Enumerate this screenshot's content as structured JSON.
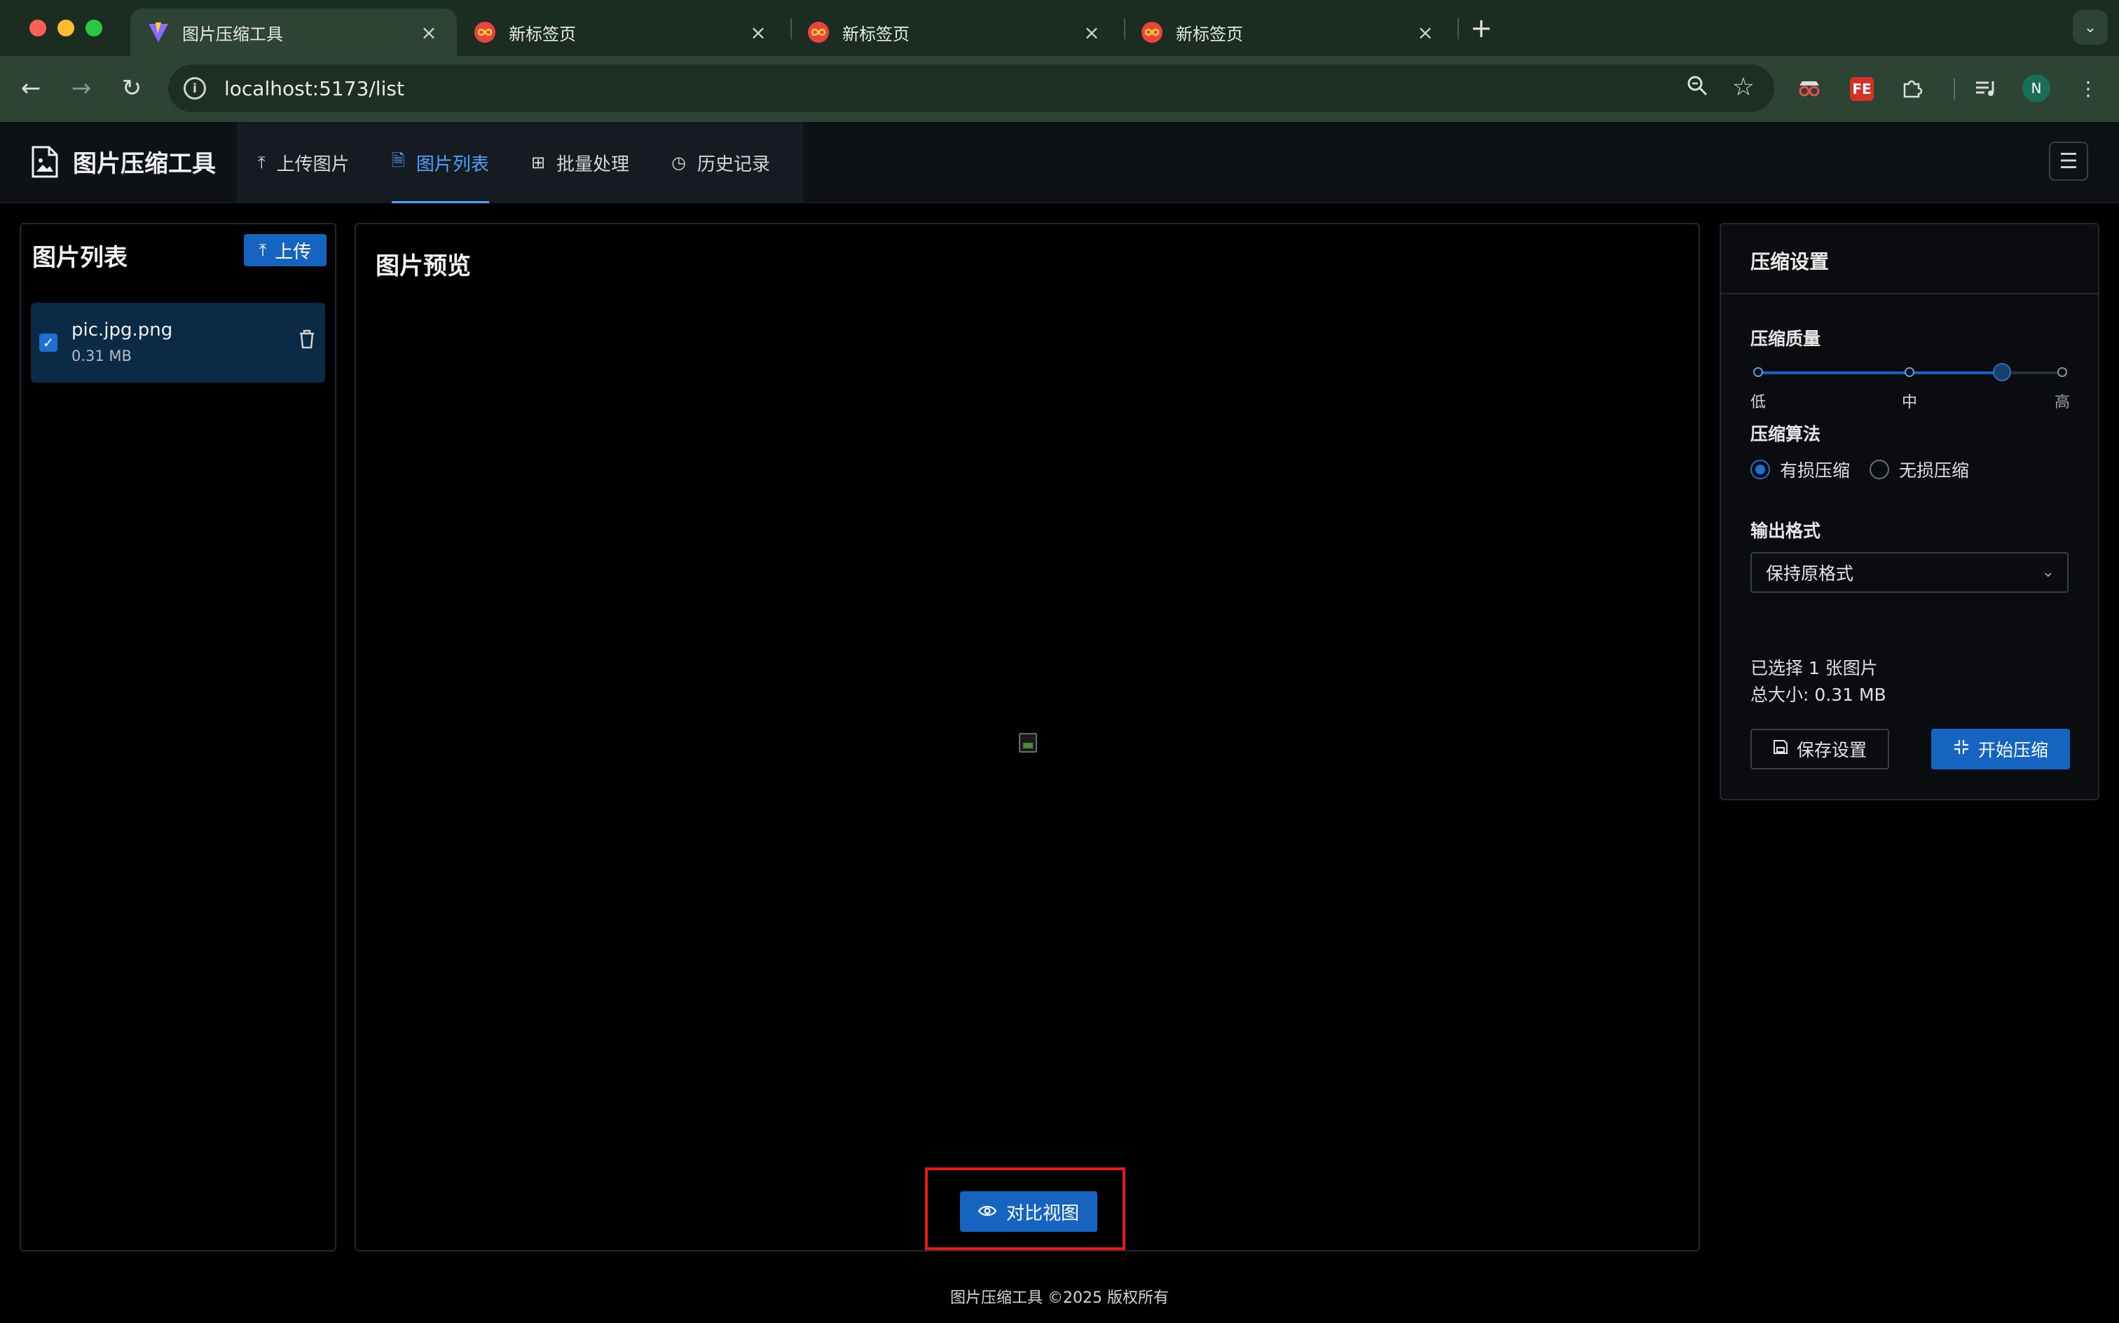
{
  "browser": {
    "tabs": [
      {
        "title": "图片压缩工具",
        "active": true,
        "favicon": "vite-icon"
      },
      {
        "title": "新标签页",
        "active": false,
        "favicon": "infinity-icon"
      },
      {
        "title": "新标签页",
        "active": false,
        "favicon": "infinity-icon"
      },
      {
        "title": "新标签页",
        "active": false,
        "favicon": "infinity-icon"
      }
    ],
    "url": "localhost:5173/list",
    "profile_initial": "N",
    "extension_fe": "FE"
  },
  "app": {
    "brand": "图片压缩工具",
    "nav": [
      {
        "label": "上传图片",
        "icon": "upload-icon",
        "active": false
      },
      {
        "label": "图片列表",
        "icon": "file-image-icon",
        "active": true
      },
      {
        "label": "批量处理",
        "icon": "grid-icon",
        "active": false
      },
      {
        "label": "历史记录",
        "icon": "clock-icon",
        "active": false
      }
    ]
  },
  "image_list": {
    "title": "图片列表",
    "upload_label": "上传",
    "files": [
      {
        "name": "pic.jpg.png",
        "size": "0.31 MB",
        "checked": true
      }
    ]
  },
  "preview": {
    "title": "图片预览",
    "compare_label": "对比视图"
  },
  "settings": {
    "title": "压缩设置",
    "quality_label": "压缩质量",
    "quality_marks": [
      "低",
      "中",
      "高"
    ],
    "quality_level": 0.85,
    "algorithm_label": "压缩算法",
    "algorithms": [
      {
        "label": "有损压缩",
        "selected": true
      },
      {
        "label": "无损压缩",
        "selected": false
      }
    ],
    "format_label": "输出格式",
    "format_value": "保持原格式",
    "selected_count": "已选择 1 张图片",
    "total_size": "总大小: 0.31 MB",
    "save_label": "保存设置",
    "start_label": "开始压缩"
  },
  "footer": "图片压缩工具 ©2025 版权所有",
  "colors": {
    "accent": "#1565c0",
    "nav_active": "#4ba3ff",
    "highlight": "#e01b1b"
  }
}
